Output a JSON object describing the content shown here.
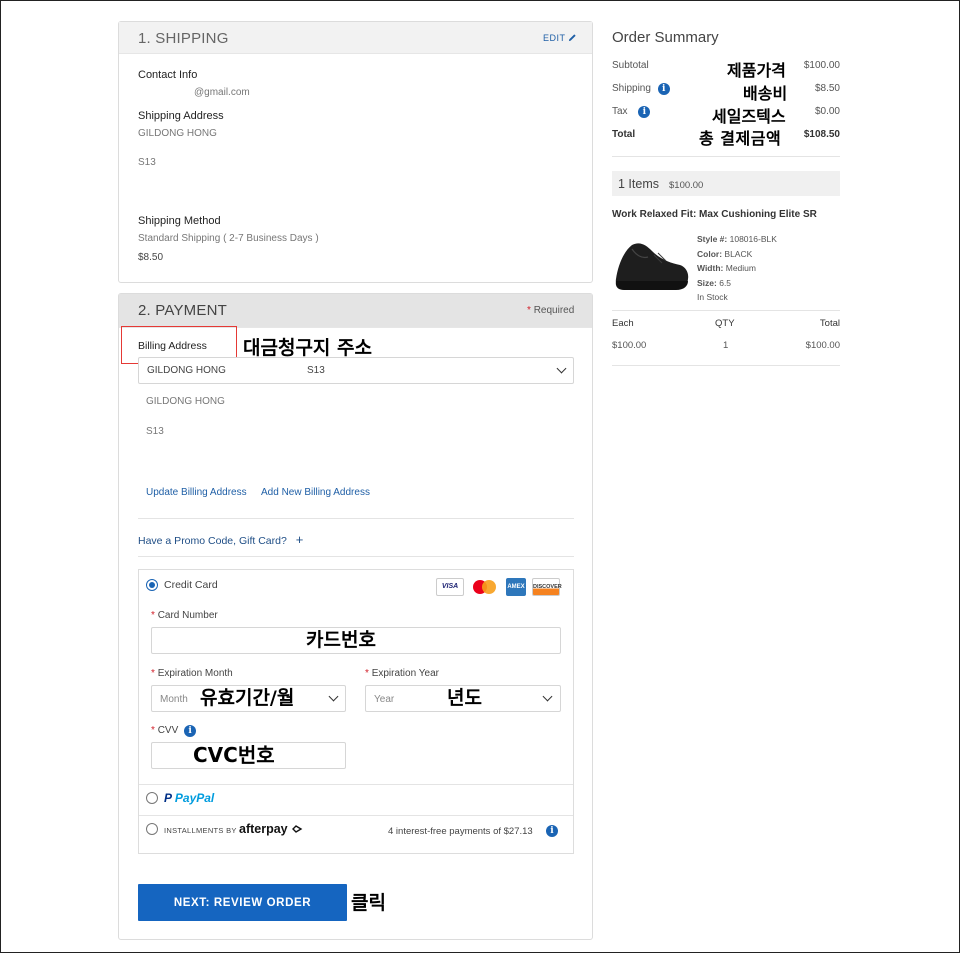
{
  "shipping": {
    "title": "1. SHIPPING",
    "edit_label": "EDIT",
    "contact_label": "Contact Info",
    "contact_email": "@gmail.com",
    "address_label": "Shipping Address",
    "address_name": "GILDONG HONG",
    "address_line": "S13",
    "method_label": "Shipping Method",
    "method_value": "Standard Shipping ( 2-7 Business Days )",
    "method_price": "$8.50"
  },
  "payment": {
    "title": "2. PAYMENT",
    "required_label": "Required",
    "billing_label": "Billing Address",
    "billing_select_name": "GILDONG HONG",
    "billing_select_line": "S13",
    "billing_name": "GILDONG HONG",
    "billing_line": "S13",
    "update_billing": "Update Billing Address",
    "add_billing": "Add New Billing Address",
    "promo_label": "Have a Promo Code, Gift Card?",
    "promo_plus": "+",
    "credit_card_label": "Credit Card",
    "card_number_label": "Card Number",
    "exp_month_label": "Expiration Month",
    "exp_month_placeholder": "Month",
    "exp_year_label": "Expiration Year",
    "exp_year_placeholder": "Year",
    "cvv_label": "CVV",
    "paypal_label": "PayPal",
    "installments_label": "INSTALLMENTS BY",
    "afterpay_label": "afterpay",
    "afterpay_note": "4 interest-free payments of $27.13",
    "next_button": "NEXT: REVIEW ORDER",
    "card_logos": [
      "VISA",
      "mastercard",
      "AMEX",
      "DISCOVER"
    ]
  },
  "summary": {
    "title": "Order Summary",
    "rows": [
      {
        "label": "Subtotal",
        "value": "$100.00"
      },
      {
        "label": "Shipping",
        "value": "$8.50"
      },
      {
        "label": "Tax",
        "value": "$0.00"
      },
      {
        "label": "Total",
        "value": "$108.50"
      }
    ],
    "items_count": "1 Items",
    "items_total": "$100.00",
    "product_name": "Work Relaxed Fit: Max Cushioning Elite SR",
    "style_label": "Style #:",
    "style_value": "108016-BLK",
    "color_label": "Color:",
    "color_value": "BLACK",
    "width_label": "Width:",
    "width_value": "Medium",
    "size_label": "Size:",
    "size_value": "6.5",
    "stock": "In Stock",
    "col_each": "Each",
    "col_qty": "QTY",
    "col_total": "Total",
    "each_value": "$100.00",
    "qty_value": "1",
    "total_value": "$100.00"
  },
  "annotations": {
    "product_price": "제품가격",
    "shipping_fee": "배송비",
    "sales_tax": "세일즈텍스",
    "total_amount": "총 결제금액",
    "billing_address": "대금청구지 주소",
    "card_number": "카드번호",
    "expiry_month": "유효기간/월",
    "year": "년도",
    "cvc": "CVC번호",
    "click": "클릭"
  },
  "colors": {
    "primary_button": "#1565c0",
    "link": "#1f5fa6",
    "required": "#d2212b",
    "highlight_box": "#e53935"
  }
}
